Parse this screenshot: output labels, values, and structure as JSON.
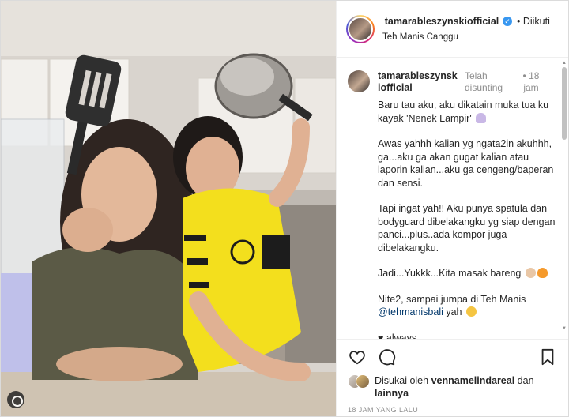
{
  "header": {
    "username": "tamarableszynskiofficial",
    "verified": true,
    "follow_status": "• Diikuti",
    "location": "Teh Manis Canggu"
  },
  "caption": {
    "username": "tamarableszynskiofficial",
    "edited": "Telah disunting",
    "time": "• 18 jam",
    "paragraphs": [
      "Baru tau aku, aku dikatain muka tua ku kayak 'Nenek Lampir'",
      "Awas yahhh kalian yg ngata2in akuhhh, ga...aku ga akan gugat kalian atau laporin kalian...aku ga cengeng/baperan dan sensi.",
      "Tapi ingat yah!! Aku punya spatula dan bodyguard dibelakangku yg siap dengan panci...plus..ada kompor juga dibelakangku.",
      "Jadi...Yukkk...Kita masak bareng",
      "Nite2, sampai jumpa di Teh Manis",
      "@tehmanisbali",
      "yah",
      "♥ always,"
    ],
    "emojis": [
      "ghost",
      "cook",
      "fire",
      "smile"
    ]
  },
  "actions": {
    "like_icon": "heart-icon",
    "comment_icon": "comment-icon",
    "save_icon": "bookmark-icon"
  },
  "likes": {
    "prefix": "Disukai oleh",
    "user": "vennamelindareal",
    "suffix": "dan",
    "others": "lainnya"
  },
  "timestamp": "18 JAM YANG LALU",
  "colors": {
    "verified_blue": "#3897f0",
    "mention": "#00376b",
    "muted": "#8e8e8e",
    "jersey_yellow": "#f3df1d"
  }
}
